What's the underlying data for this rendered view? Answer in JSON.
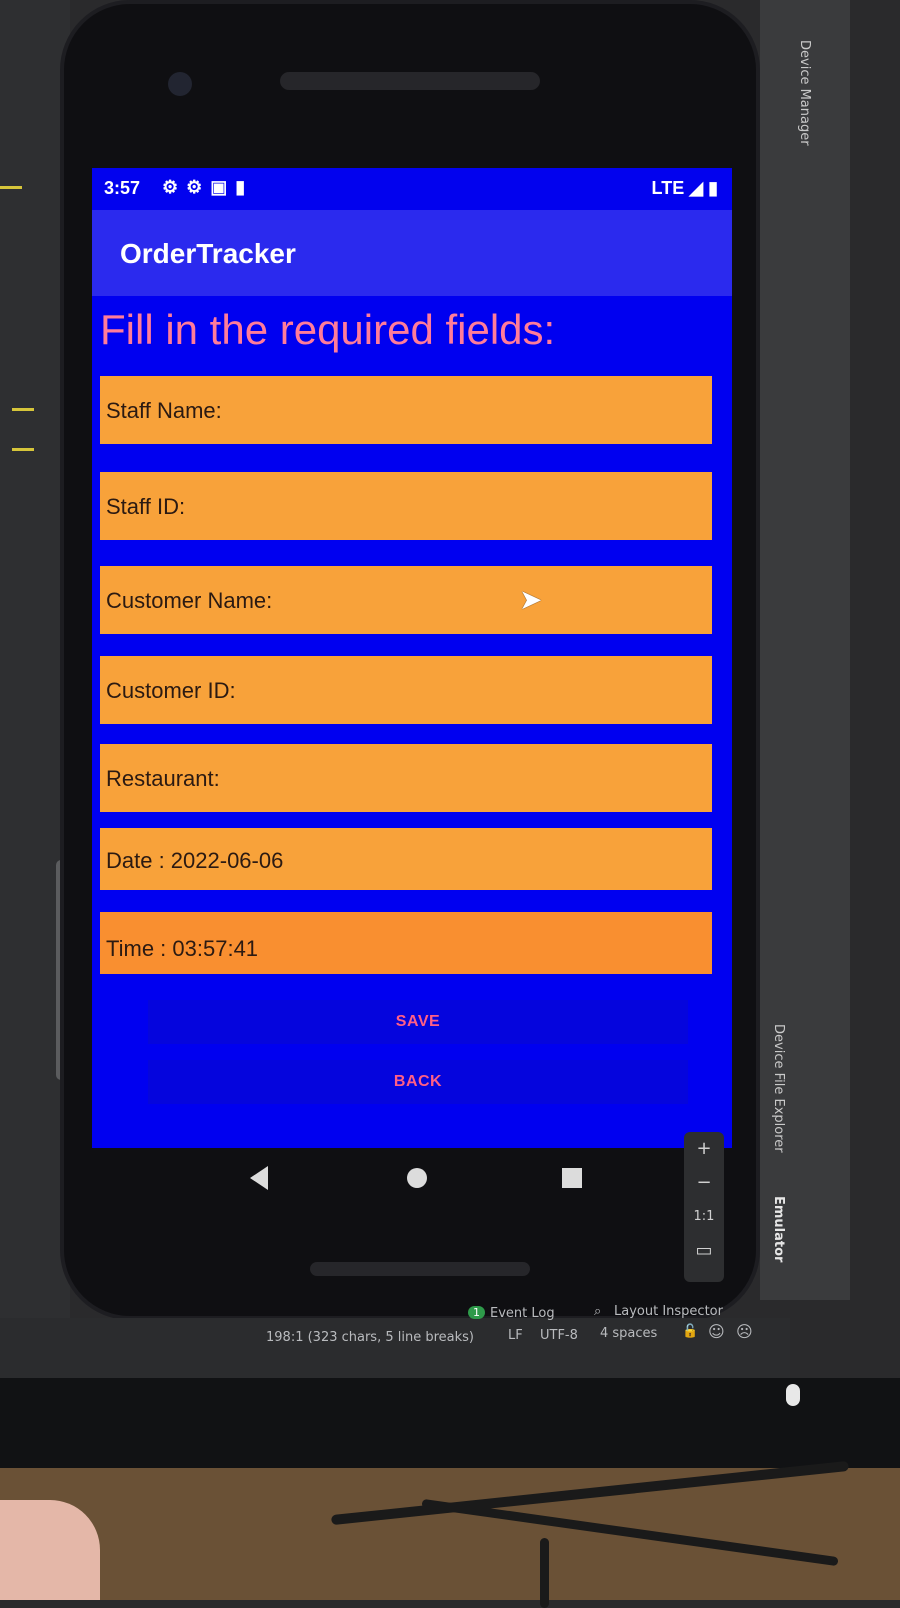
{
  "ide": {
    "device_manager_label": "Device Manager",
    "device_file_explorer_label": "Device File Explorer",
    "emulator_label": "Emulator",
    "event_log_label": "Event Log",
    "event_log_badge": "1",
    "layout_inspector_label": "Layout Inspector",
    "cursor_position": "198:1 (323 chars, 5 line breaks)",
    "line_ending": "LF",
    "encoding": "UTF-8",
    "indent": "4 spaces",
    "emulator_controls": [
      "+",
      "−",
      "1:1",
      "▭"
    ]
  },
  "android": {
    "status_time": "3:57",
    "status_icons": [
      "gear-icon",
      "gear-icon",
      "notification-icon",
      "sd-card-icon"
    ],
    "network": "LTE",
    "app_title": "OrderTracker",
    "heading": "Fill in the required fields:",
    "fields": [
      {
        "label": "Staff Name:"
      },
      {
        "label": "Staff ID:"
      },
      {
        "label": "Customer Name:"
      },
      {
        "label": "Customer ID:"
      },
      {
        "label": "Restaurant:"
      },
      {
        "label": "Date : 2022-06-06"
      },
      {
        "label": "Time : 03:57:41"
      }
    ],
    "save_label": "SAVE",
    "back_label": "BACK"
  },
  "colors": {
    "screen_bg": "#0000f0",
    "field_bg": "#f8a23a",
    "heading_text": "#ff7c9a",
    "button_text": "#ff5f86"
  }
}
